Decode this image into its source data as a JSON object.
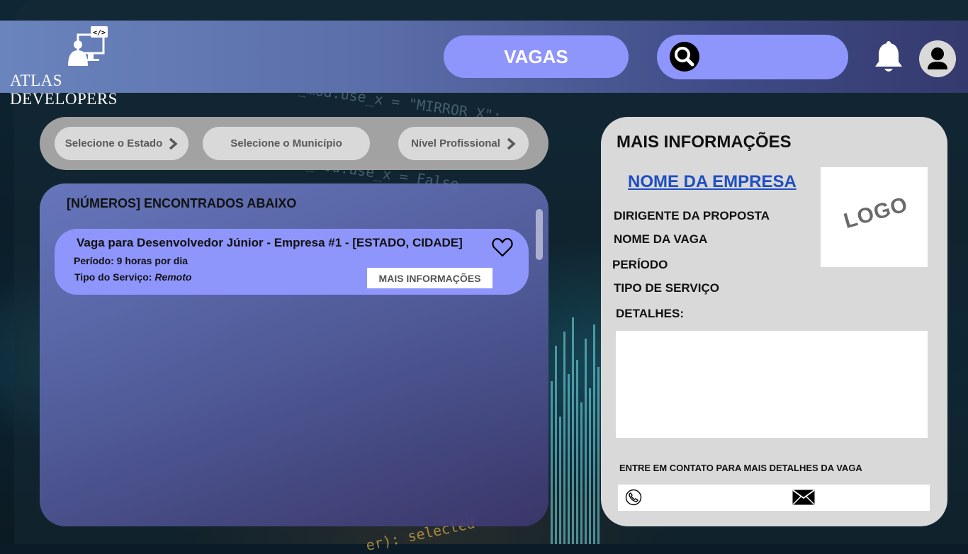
{
  "header": {
    "brand": "ATLAS DEVELOPERS",
    "vagas_label": "VAGAS",
    "search_placeholder": ""
  },
  "filters": {
    "estado": "Selecione o Estado",
    "municipio": "Selecione o Município",
    "nivel": "Nível Profissional"
  },
  "results": {
    "title": "[NÚMEROS] ENCONTRADOS ABAIXO",
    "jobs": [
      {
        "title": "Vaga para Desenvolvedor Júnior - Empresa #1 - [ESTADO, CIDADE]",
        "period_label": "Período:",
        "period_value": "9 horas por dia",
        "service_label": "Tipo do Serviço:",
        "service_value": "Remoto",
        "more_label": "MAIS INFORMAÇÕES"
      }
    ]
  },
  "info": {
    "title": "MAIS INFORMAÇÕES",
    "company": "NOME DA EMPRESA",
    "logo": "LOGO",
    "fields": [
      "DIRIGENTE DA PROPOSTA",
      "NOME DA VAGA",
      "PERÍODO",
      "TIPO DE SERVIÇO"
    ],
    "details_label": "DETALHES:",
    "contact_text": "ENTRE EM CONTATO PARA MAIS DETALHES DA VAGA"
  },
  "background_code": [
    "irror_mod.use_x = \"MIRROR_X\":",
    "mirror_mod.use_x = False",
    "er): selected"
  ],
  "colors": {
    "accent": "#8e95fb",
    "panel": "#d9d9d9",
    "link": "#1e4ec2"
  }
}
